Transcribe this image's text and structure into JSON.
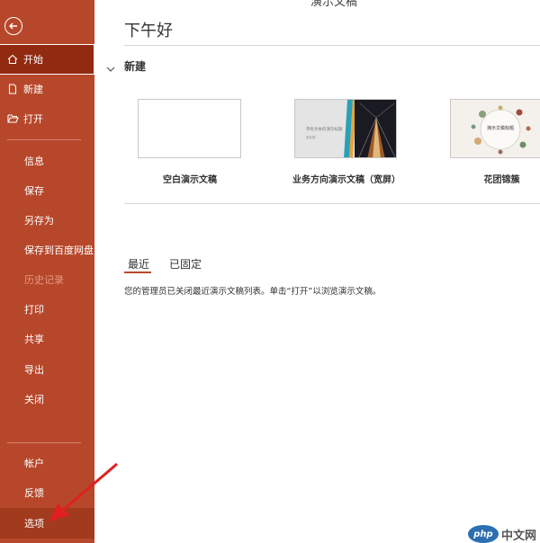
{
  "window": {
    "title": "演示文稿"
  },
  "sidebar": {
    "top_items": [
      {
        "label": "开始",
        "icon": "home-icon",
        "active": true
      },
      {
        "label": "新建",
        "icon": "new-document-icon"
      },
      {
        "label": "打开",
        "icon": "open-folder-icon"
      }
    ],
    "middle_items": [
      {
        "label": "信息"
      },
      {
        "label": "保存"
      },
      {
        "label": "另存为"
      },
      {
        "label": "保存到百度网盘"
      },
      {
        "label": "历史记录",
        "disabled": true
      },
      {
        "label": "打印"
      },
      {
        "label": "共享"
      },
      {
        "label": "导出"
      },
      {
        "label": "关闭"
      }
    ],
    "bottom_items": [
      {
        "label": "帐户"
      },
      {
        "label": "反馈"
      },
      {
        "label": "选项",
        "highlighted": true
      }
    ]
  },
  "main": {
    "greeting": "下午好",
    "new_section": {
      "title": "新建",
      "templates": [
        {
          "label": "空白演示文稿"
        },
        {
          "label": "业务方向演示文稿（宽屏）",
          "thumb_title": "带有文本的演示标题",
          "thumb_sub": "副标题"
        },
        {
          "label": "花团锦簇",
          "thumb_title": "演示文稿标题"
        }
      ]
    },
    "tabs": [
      {
        "label": "最近",
        "active": true
      },
      {
        "label": "已固定"
      }
    ],
    "recent_message": "您的管理员已关闭最近演示文稿列表。单击“打开”以浏览演示文稿。"
  },
  "watermark": {
    "logo": "php",
    "text": "中文网"
  },
  "colors": {
    "sidebar_bg": "#b7472a",
    "active_bg": "#922a11",
    "arrow": "#e02020",
    "accent": "#b7472a"
  }
}
